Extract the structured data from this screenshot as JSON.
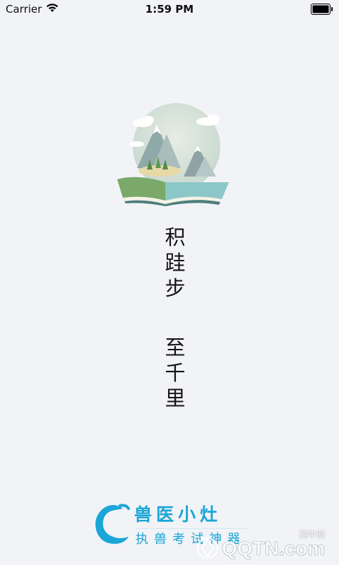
{
  "status_bar": {
    "carrier": "Carrier",
    "time": "1:59 PM"
  },
  "splash": {
    "slogan_line1": [
      "积",
      "跬",
      "步"
    ],
    "slogan_line2": [
      "至",
      "千",
      "里"
    ]
  },
  "brand": {
    "name": "兽医小灶",
    "tagline": "执兽考试神器"
  },
  "watermark": {
    "site": "腾牛网",
    "mark_text": "QQTN.com"
  }
}
